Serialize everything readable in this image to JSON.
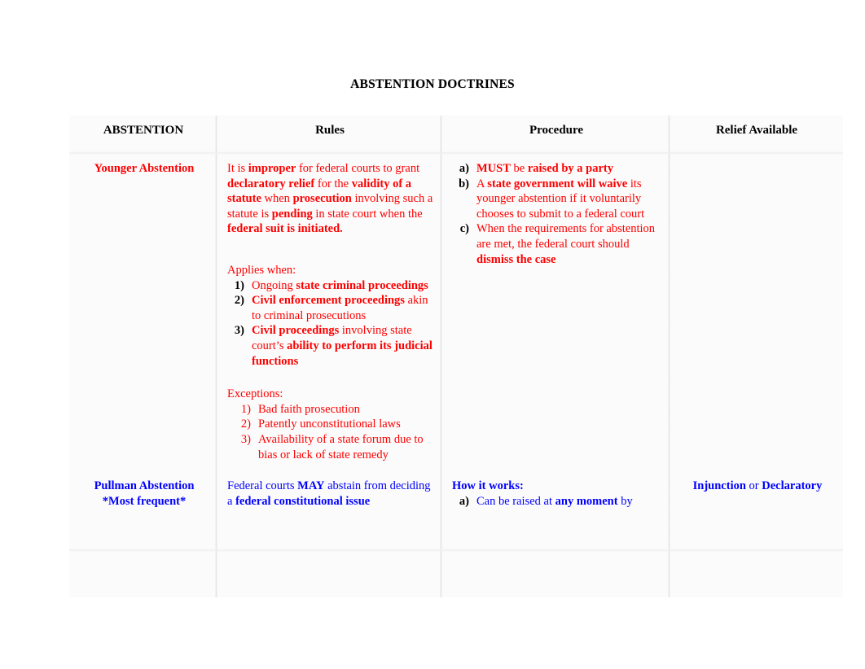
{
  "document": {
    "title": "ABSTENTION DOCTRINES"
  },
  "table": {
    "headers": [
      {
        "label": "ABSTENTION"
      },
      {
        "label": "Rules"
      },
      {
        "label": "Procedure"
      },
      {
        "label": "Relief Available"
      }
    ],
    "colors": {
      "younger_row": "#ff0000",
      "pullman_row": "#0000ff",
      "header_text": "#000000",
      "marker_black": "#000000"
    },
    "rows": [
      {
        "id": "younger",
        "color": "#ff0000",
        "abstention": {
          "name": "Younger Abstention",
          "note": ""
        },
        "rules": {
          "paragraph": [
            {
              "text": "It is ",
              "bold": false
            },
            {
              "text": "improper",
              "bold": true
            },
            {
              "text": " for federal courts to grant ",
              "bold": false
            },
            {
              "text": "declaratory relief",
              "bold": true
            },
            {
              "text": " for the ",
              "bold": false
            },
            {
              "text": "validity of a statute",
              "bold": true
            },
            {
              "text": " when ",
              "bold": false
            },
            {
              "text": "prosecution",
              "bold": true
            },
            {
              "text": " involving such a statute is ",
              "bold": false
            },
            {
              "text": "pending",
              "bold": true
            },
            {
              "text": " in state court when the ",
              "bold": false
            },
            {
              "text": "federal suit is initiated.",
              "bold": true
            }
          ],
          "applies_when_label": "Applies when:",
          "applies_when": [
            {
              "marker": "1)",
              "parts": [
                {
                  "text": "Ongoing ",
                  "bold": false
                },
                {
                  "text": "state criminal proceedings",
                  "bold": true
                }
              ]
            },
            {
              "marker": "2)",
              "parts": [
                {
                  "text": "Civil enforcement proceedings",
                  "bold": true
                },
                {
                  "text": " akin to criminal prosecutions",
                  "bold": false
                }
              ]
            },
            {
              "marker": "3)",
              "parts": [
                {
                  "text": "Civil proceedings",
                  "bold": true
                },
                {
                  "text": " involving state court’s ",
                  "bold": false
                },
                {
                  "text": "ability to perform its judicial functions",
                  "bold": true
                }
              ]
            }
          ],
          "exceptions_label": "Exceptions:",
          "exceptions": [
            {
              "marker": "1)",
              "text": "Bad faith prosecution"
            },
            {
              "marker": "2)",
              "text": "Patently unconstitutional laws"
            },
            {
              "marker": "3)",
              "text": "Availability of a state forum due to bias or lack of state remedy"
            }
          ]
        },
        "procedure": [
          {
            "marker": "a)",
            "parts": [
              {
                "text": "MUST",
                "bold": true
              },
              {
                "text": " be ",
                "bold": false
              },
              {
                "text": "raised by a party",
                "bold": true
              }
            ]
          },
          {
            "marker": "b)",
            "parts": [
              {
                "text": "A ",
                "bold": false
              },
              {
                "text": "state government will waive",
                "bold": true
              },
              {
                "text": " its younger abstention if it voluntarily chooses to submit to a federal court",
                "bold": false
              }
            ]
          },
          {
            "marker": "c)",
            "parts": [
              {
                "text": "When the requirements for abstention are met, the federal court should ",
                "bold": false
              },
              {
                "text": "dismiss the case",
                "bold": true
              }
            ]
          }
        ],
        "relief": []
      },
      {
        "id": "pullman",
        "color": "#0000ff",
        "abstention": {
          "name": "Pullman Abstention",
          "note": "*Most frequent*"
        },
        "rules": {
          "paragraph": [
            {
              "text": "Federal courts ",
              "bold": false
            },
            {
              "text": "MAY",
              "bold": true
            },
            {
              "text": " abstain from deciding a ",
              "bold": false
            },
            {
              "text": "federal constitutional issue",
              "bold": true
            }
          ],
          "applies_when_label": "",
          "applies_when": [],
          "exceptions_label": "",
          "exceptions": []
        },
        "procedure_label": "How it works:",
        "procedure": [
          {
            "marker": "a)",
            "parts": [
              {
                "text": "Can be raised at ",
                "bold": false
              },
              {
                "text": "any moment",
                "bold": true
              },
              {
                "text": " by",
                "bold": false
              }
            ]
          }
        ],
        "relief": [
          {
            "text": "Injunction",
            "bold": true
          },
          {
            "text": " or ",
            "bold": false
          },
          {
            "text": "Declaratory",
            "bold": true
          }
        ]
      }
    ]
  }
}
